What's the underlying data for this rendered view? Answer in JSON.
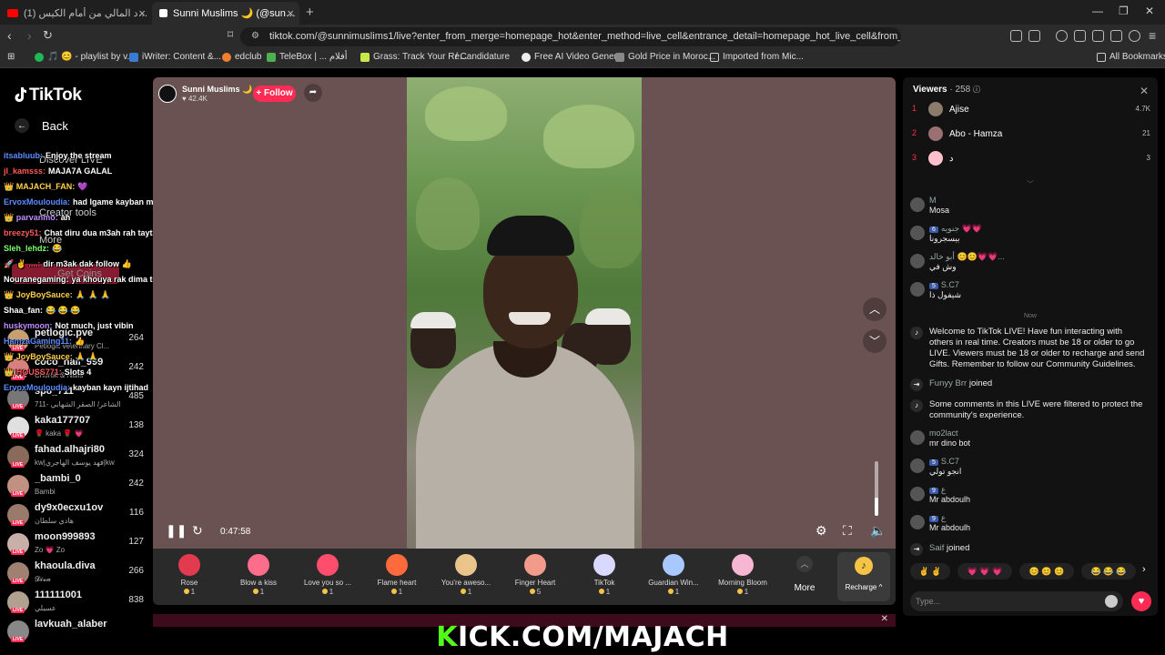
{
  "browser": {
    "tabs": [
      {
        "title": "(1) اضبك المبرد المالي من أمام الكيس"
      },
      {
        "title": "Sunni Muslims 🌙 (@sunnimuslims1)"
      }
    ],
    "url": "tiktok.com/@sunnimuslims1/live?enter_from_merge=homepage_hot&enter_method=live_cell&entrance_detail=homepage_hot_live_cell&from_...",
    "bookmarks": [
      "🎵 😊 - playlist by v...",
      "iWriter: Content &...",
      "edclub",
      "TeleBox | ... أفلام",
      "Grass: Track Your Re...",
      "/ Candidature",
      "Free AI Video Gener...",
      "Gold Price in Moroc...",
      "Imported from Mic..."
    ],
    "all_bookmarks": "All Bookmarks"
  },
  "sidebar": {
    "logo": "TikTok",
    "back": "Back",
    "nav": [
      "Discover LIVE",
      "Creator tools",
      "More"
    ],
    "get_coins": "Get Coins",
    "recommended": [
      {
        "name": "petlogic.pve",
        "sub": "Petlogic veterinary Cl...",
        "count": "264",
        "color": "#c8a070"
      },
      {
        "name": "coco_nail_999",
        "sub": "Chorok & Nails",
        "count": "242",
        "color": "#d88080"
      },
      {
        "name": "sp8_711",
        "sub": "711- الشاعر/ الصقر الشهابي",
        "count": "485",
        "color": "#777777"
      },
      {
        "name": "kaka177707",
        "sub": "🌹 kaka 🌹 💗",
        "count": "138",
        "color": "#e0e0e0"
      },
      {
        "name": "fahad.alhajri80",
        "sub": "kw|فهد يوسف الهاجري|kw",
        "count": "324",
        "color": "#8a6a5a"
      },
      {
        "name": "_bambi_0",
        "sub": "Bambi",
        "count": "242",
        "color": "#c09080"
      },
      {
        "name": "dy9x0ecxu1ov",
        "sub": "هادي سلطان",
        "count": "116",
        "color": "#9a7a6a"
      },
      {
        "name": "moon999893",
        "sub": "Zo 💗 Zo",
        "count": "127",
        "color": "#c8b0a8"
      },
      {
        "name": "khaoula.diva",
        "sub": "𝓓𝓲𝓿𝓪",
        "count": "266",
        "color": "#a08070"
      },
      {
        "name": "111111001",
        "sub": "عسيلي",
        "count": "838",
        "color": "#b0a090"
      },
      {
        "name": "lavkuah_alaber",
        "sub": "",
        "count": "",
        "color": "#888888"
      }
    ]
  },
  "chat_overlay": [
    {
      "user": "itsabluub:",
      "text": "Enjoy the stream",
      "color": "#5b8cff"
    },
    {
      "user": "jl_kamsss:",
      "text": "MAJA7A GALAL",
      "color": "#ff5a5a"
    },
    {
      "user": "👑 MAJACH_FAN:",
      "text": "💜",
      "color": "#ffd24a"
    },
    {
      "user": "ErvoxMouloudia:",
      "text": "had lgame kayban mzyan",
      "color": "#5b8cff"
    },
    {
      "user": "👑 parvanmo:",
      "text": "ah",
      "color": "#c28cff"
    },
    {
      "user": "breezy51:",
      "text": "Chat diru dua m3ah rah tayt3edeb",
      "color": "#ff5a5a"
    },
    {
      "user": "Sleh_lehdz:",
      "text": "😂",
      "color": "#7cff6b"
    },
    {
      "user": "🚀 ✌ ....:",
      "text": "dir m3ak dak follow 👍",
      "color": "#ff5a5a"
    },
    {
      "user": "Nouranegaming:",
      "text": "ya khouya rak dima top",
      "color": "#ffffff"
    },
    {
      "user": "👑 JoyBoySauce:",
      "text": "🙏 🙏 🙏",
      "color": "#ffd24a"
    },
    {
      "user": "Shaa_fan:",
      "text": "😂 😂 😂",
      "color": "#ffffff"
    },
    {
      "user": "huskymoon:",
      "text": "Not much, just vibin",
      "color": "#c28cff"
    },
    {
      "user": "HamzaGaming11:",
      "text": "👍",
      "color": "#5b8cff"
    },
    {
      "user": "👑 JoyBoySauce:",
      "text": "🙏 🙏",
      "color": "#ffd24a"
    },
    {
      "user": "👑 HOUSS771:",
      "text": "Slots 4",
      "color": "#ff5a5a"
    },
    {
      "user": "ErvoxMouloudia:",
      "text": "kayban kayn ijtihad",
      "color": "#5b8cff"
    }
  ],
  "player": {
    "host_name": "Sunni Muslims 🌙",
    "host_likes": "♥ 42.4K",
    "follow": "+ Follow",
    "time": "0:47:58",
    "volume_level": 0.33
  },
  "gifts": [
    {
      "name": "Rose",
      "cost": "1",
      "color": "#e23a4f"
    },
    {
      "name": "Blow a kiss",
      "cost": "1",
      "color": "#ff6d8a"
    },
    {
      "name": "Love you so ...",
      "cost": "1",
      "color": "#ff4d6d"
    },
    {
      "name": "Flame heart",
      "cost": "1",
      "color": "#ff6a3d"
    },
    {
      "name": "You're aweso...",
      "cost": "1",
      "color": "#e9c48b"
    },
    {
      "name": "Finger Heart",
      "cost": "5",
      "color": "#f29b8b"
    },
    {
      "name": "TikTok",
      "cost": "1",
      "color": "#d9d9ff"
    },
    {
      "name": "Guardian Win...",
      "cost": "1",
      "color": "#a8c8ff"
    },
    {
      "name": "Morning Bloom",
      "cost": "1",
      "color": "#f7b6d2"
    }
  ],
  "gift_more": "More",
  "recharge": "Recharge ^",
  "banner": {
    "k": "K",
    "rest": "ICK.COM/MAJACH"
  },
  "viewers_panel": {
    "title": "Viewers",
    "count": "· 258",
    "top": [
      {
        "rank": "1",
        "name": "Ajise",
        "score": "4.7K",
        "color": "#8c7a6a"
      },
      {
        "rank": "2",
        "name": "Abo - Hamza",
        "score": "21",
        "color": "#9a7070"
      },
      {
        "rank": "3",
        "name": "د",
        "score": "3",
        "color": "#ffc0cb"
      }
    ]
  },
  "comments": [
    {
      "user": "M",
      "text": "Mosa",
      "level": ""
    },
    {
      "user": "جنويه 💗💗",
      "text": "بيسجرونا",
      "level": "6"
    },
    {
      "user": "أبو خالد 😊😊💗💗...",
      "text": "وش في",
      "level": ""
    },
    {
      "user": "S.C7",
      "text": "شيفول ذا",
      "level": "5"
    }
  ],
  "now_label": "Now",
  "system_msg": "Welcome to TikTok LIVE! Have fun interacting with others in real time. Creators must be 18 or older to go LIVE. Viewers must be 18 or older to recharge and send Gifts. Remember to follow our Community Guidelines.",
  "join1": {
    "user": "Funyy Brr",
    "text": "joined"
  },
  "filter_msg": "Some comments in this LIVE were filtered to protect the community's experience.",
  "comments2": [
    {
      "user": "mo2lact",
      "text": "mr dino bot",
      "level": ""
    },
    {
      "user": "S.C7",
      "text": "انجو تولي",
      "level": "5"
    },
    {
      "user": "ع",
      "text": "Mr abdoulh",
      "level": "9"
    },
    {
      "user": "ع",
      "text": "Mr abdoulh",
      "level": "9"
    }
  ],
  "join2": {
    "user": "Saif",
    "text": "joined"
  },
  "reactions": [
    "✌ ✌",
    "💗 💗 💗",
    "😊 😊 😊",
    "😂 😂 😂"
  ],
  "type_placeholder": "Type..."
}
